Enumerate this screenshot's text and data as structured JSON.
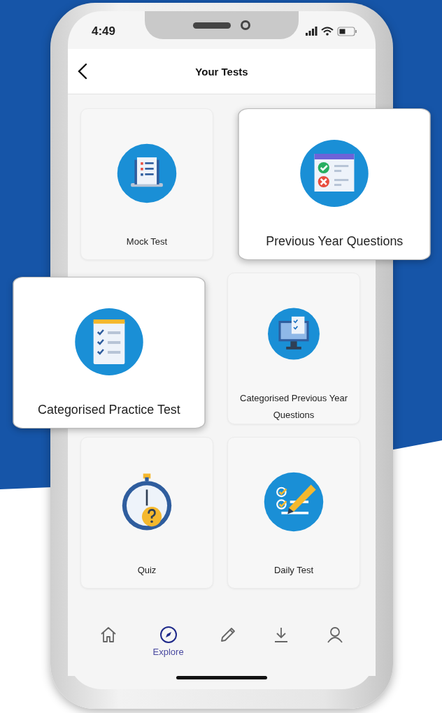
{
  "status_bar": {
    "time": "4:49"
  },
  "header": {
    "title": "Your Tests"
  },
  "cards": [
    {
      "kind": "mock",
      "label": "Mock Test",
      "highlighted": false
    },
    {
      "kind": "previous",
      "label": "Previous Year Questions",
      "highlighted": true
    },
    {
      "kind": "practice",
      "label": "Categorised Practice Test",
      "highlighted": true
    },
    {
      "kind": "categorised-previous",
      "label": "Categorised Previous Year Questions",
      "highlighted": false
    },
    {
      "kind": "quiz",
      "label": "Quiz",
      "highlighted": false
    },
    {
      "kind": "daily",
      "label": "Daily Test",
      "highlighted": false
    }
  ],
  "nav": [
    {
      "kind": "home",
      "selected": false
    },
    {
      "kind": "explore",
      "label": "Explore",
      "selected": true
    },
    {
      "kind": "edit",
      "selected": false
    },
    {
      "kind": "downloads",
      "selected": false
    },
    {
      "kind": "profile",
      "selected": false
    }
  ]
}
